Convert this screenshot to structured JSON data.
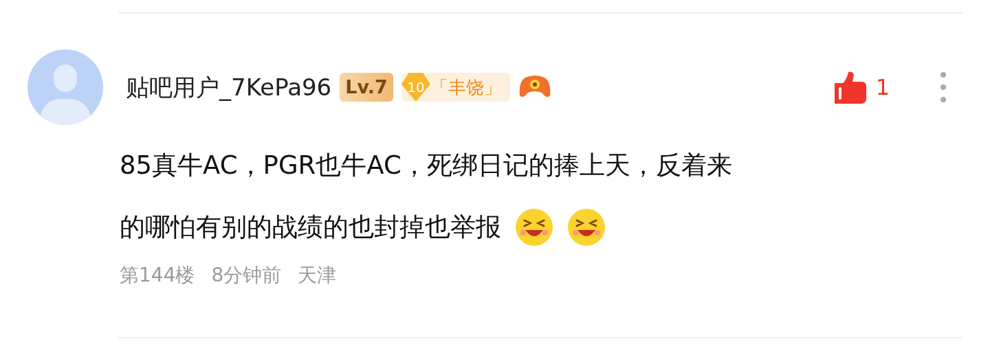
{
  "comment": {
    "user": {
      "name": "贴吧用户_7KePa96",
      "level_badge": "Lv.7",
      "tier_number": "10",
      "tier_title": "「丰饶」"
    },
    "like": {
      "liked": true,
      "count": "1"
    },
    "text_lines": [
      "85真牛AC，PGR也牛AC，死绑日记的捧上天，反着来",
      "的哪怕有别的战绩的也封掉也举报"
    ],
    "emojis": [
      {
        "kind": "laugh"
      },
      {
        "kind": "laugh"
      }
    ],
    "meta": [
      "第144楼",
      "8分钟前",
      "天津"
    ]
  }
}
